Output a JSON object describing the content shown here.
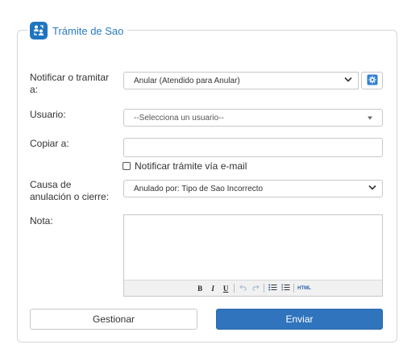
{
  "panel": {
    "title": "Trámite de Sao",
    "icon": "people-exchange-icon",
    "accent_color": "#1f76c0"
  },
  "form": {
    "notify_label": "Notificar o tramitar a:",
    "notify_value": "Anular (Atendido para Anular)",
    "user_label": "Usuario:",
    "user_placeholder": "--Selecciona un usuario--",
    "copy_label": "Copiar a:",
    "copy_value": "",
    "email_checkbox_label": "Notificar trámite vía e-mail",
    "email_checked": false,
    "cause_label": "Causa de anulación o cierre:",
    "cause_value": "Anulado por: Tipo de Sao Incorrecto",
    "note_label": "Nota:",
    "note_value": ""
  },
  "editor_toolbar": {
    "bold": "B",
    "italic": "I",
    "underline": "U",
    "undo_icon": "undo-icon",
    "redo_icon": "redo-icon",
    "bullet_list_icon": "bullet-list-icon",
    "numbered_list_icon": "numbered-list-icon",
    "html": "HTML"
  },
  "actions": {
    "manage_label": "Gestionar",
    "send_label": "Enviar",
    "primary_color": "#2f74bd"
  }
}
